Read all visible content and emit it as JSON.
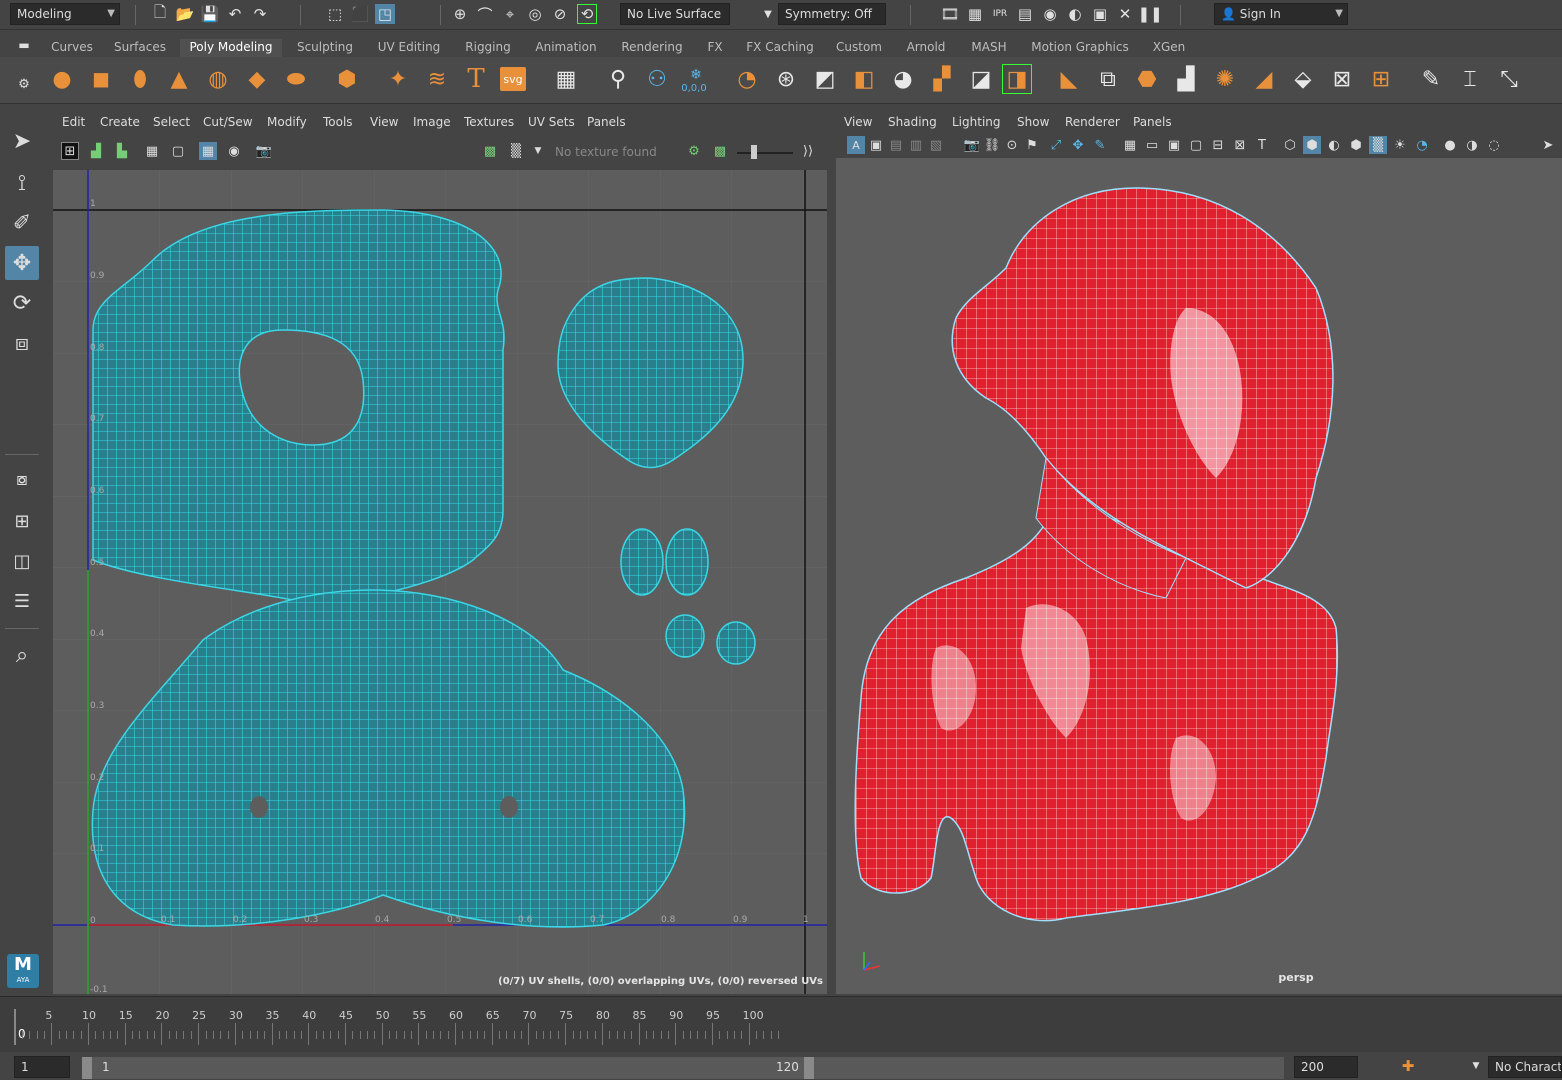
{
  "status": {
    "mode_menu": "Modeling",
    "live_surface": "No Live Surface",
    "symmetry": "Symmetry: Off",
    "sign_in": "Sign In"
  },
  "shelf_tabs": [
    "Curves",
    "Surfaces",
    "Poly Modeling",
    "Sculpting",
    "UV Editing",
    "Rigging",
    "Animation",
    "Rendering",
    "FX",
    "FX Caching",
    "Custom",
    "Arnold",
    "MASH",
    "Motion Graphics",
    "XGen"
  ],
  "shelf_active": "Poly Modeling",
  "shelf_text_icons": {
    "text": "T",
    "svg": "svg",
    "coords": "0,0,0"
  },
  "uv_editor": {
    "menu": [
      "Edit",
      "Create",
      "Select",
      "Cut/Sew",
      "Modify",
      "Tools",
      "View",
      "Image",
      "Textures",
      "UV Sets",
      "Panels"
    ],
    "texture_field": "No texture found",
    "status_text": "(0/7) UV shells, (0/0) overlapping UVs, (0/0) reversed UVs",
    "v_labels": [
      "1",
      "0.9",
      "0.8",
      "0.7",
      "0.6",
      "0.5",
      "0.4",
      "0.3",
      "0.2",
      "0.1",
      "0",
      "-0.1"
    ],
    "u_labels": [
      "0.1",
      "0.2",
      "0.3",
      "0.4",
      "0.5",
      "0.6",
      "0.7",
      "0.8",
      "0.9",
      "1"
    ],
    "uv_color": "#27c9d8"
  },
  "viewport": {
    "menu": [
      "View",
      "Shading",
      "Lighting",
      "Show",
      "Renderer",
      "Panels"
    ],
    "camera_label": "persp",
    "mesh_color": "#e0202e",
    "wire_color": "#9fe0ff"
  },
  "toolbox": {
    "logo": "M",
    "logo_sub": "AYA"
  },
  "timeline": {
    "current": "0",
    "ticks": [
      "5",
      "10",
      "15",
      "20",
      "25",
      "30",
      "35",
      "40",
      "45",
      "50",
      "55",
      "60",
      "65",
      "70",
      "75",
      "80",
      "85",
      "90",
      "95",
      "100"
    ]
  },
  "range": {
    "start": "1",
    "inner_start": "1",
    "inner_end": "120",
    "end": "200",
    "character": "No Charact"
  }
}
